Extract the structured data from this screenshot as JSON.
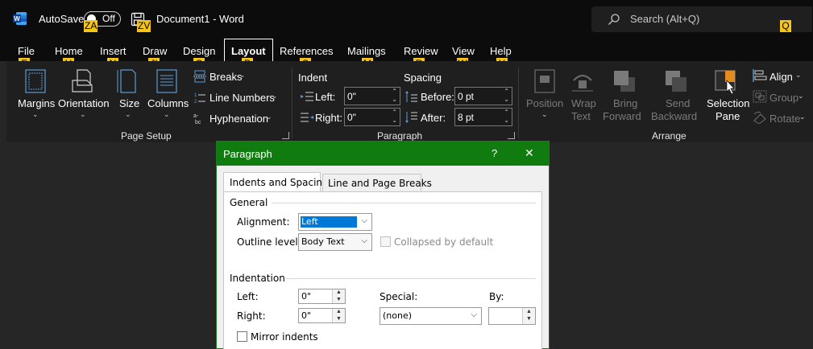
{
  "titlebar": {
    "autosave_label": "AutoSave",
    "autosave_state": "Off",
    "doc_title": "Document1  -  Word",
    "search_placeholder": "Search (Alt+Q)"
  },
  "keytips": {
    "autosave": "ZA",
    "doc": "ZV",
    "search": "Q",
    "file": "F",
    "home": "H",
    "insert": "N",
    "draw": "JI",
    "design": "G",
    "layout": "P",
    "references": "S",
    "mailings": "M",
    "review": "R",
    "view": "W",
    "help": "Y"
  },
  "tabs": [
    "File",
    "Home",
    "Insert",
    "Draw",
    "Design",
    "Layout",
    "References",
    "Mailings",
    "Review",
    "View",
    "Help"
  ],
  "ribbon": {
    "page_setup": {
      "margins": "Margins",
      "orientation": "Orientation",
      "size": "Size",
      "columns": "Columns",
      "breaks": "Breaks",
      "line_numbers": "Line Numbers",
      "hyphenation": "Hyphenation",
      "group_label": "Page Setup"
    },
    "paragraph": {
      "indent_header": "Indent",
      "spacing_header": "Spacing",
      "left_label": "Left:",
      "left_value": "0\"",
      "right_label": "Right:",
      "right_value": "0\"",
      "before_label": "Before:",
      "before_value": "0 pt",
      "after_label": "After:",
      "after_value": "8 pt",
      "group_label": "Paragraph"
    },
    "arrange": {
      "position": "Position",
      "wrap_1": "Wrap",
      "wrap_2": "Text",
      "bring_1": "Bring",
      "bring_2": "Forward",
      "send_1": "Send",
      "send_2": "Backward",
      "selection_1": "Selection",
      "selection_2": "Pane",
      "align": "Align",
      "group": "Group",
      "rotate": "Rotate",
      "group_label": "Arrange"
    }
  },
  "dialog": {
    "title": "Paragraph",
    "help": "?",
    "close": "✕",
    "tab_indents": "Indents and Spacing",
    "tab_breaks": "Line and Page Breaks",
    "general_header": "General",
    "alignment_label": "Alignment:",
    "alignment_value": "Left",
    "outline_label": "Outline level:",
    "outline_value": "Body Text",
    "collapsed_label": "Collapsed by default",
    "indentation_header": "Indentation",
    "left_label": "Left:",
    "left_value": "0\"",
    "right_label": "Right:",
    "right_value": "0\"",
    "special_label": "Special:",
    "special_value": "(none)",
    "by_label": "By:",
    "by_value": "",
    "mirror_label": "Mirror indents"
  },
  "colors": {
    "accent_green": "#107c10",
    "keytip_yellow": "#f5c518",
    "background": "#262626",
    "ribbon": "#1f1f1f"
  }
}
